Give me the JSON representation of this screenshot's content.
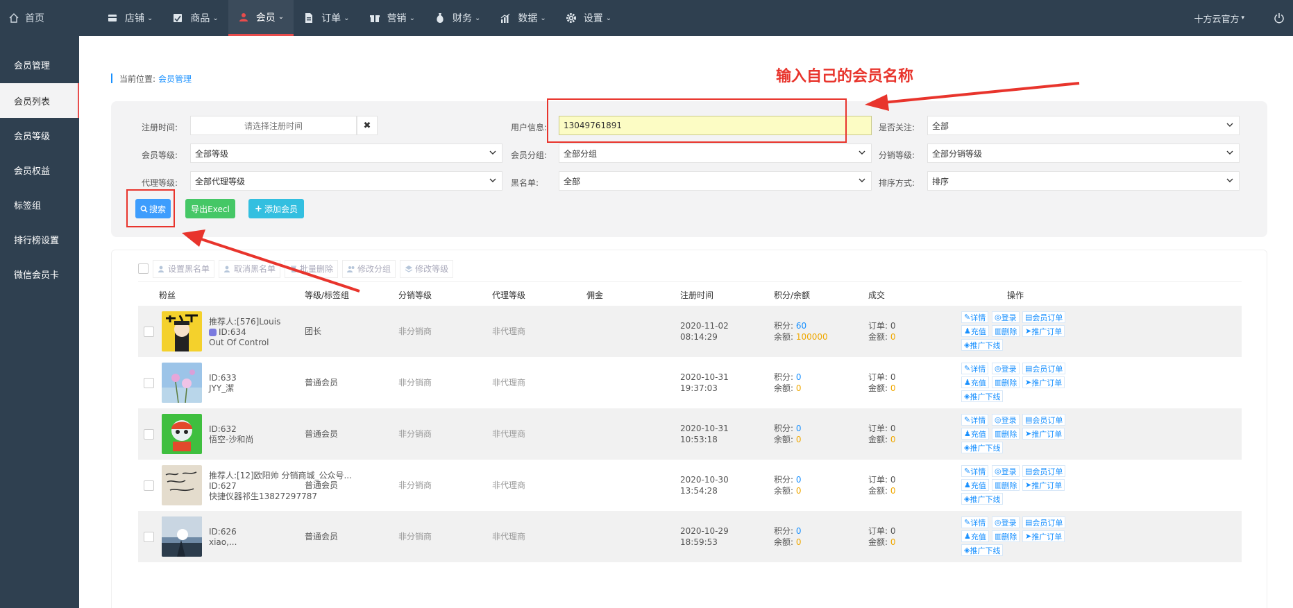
{
  "topnav": {
    "home": "首页",
    "items": [
      {
        "label": "店铺",
        "icon": "store-icon"
      },
      {
        "label": "商品",
        "icon": "product-icon"
      },
      {
        "label": "会员",
        "icon": "member-icon"
      },
      {
        "label": "订单",
        "icon": "order-icon"
      },
      {
        "label": "营销",
        "icon": "gift-icon"
      },
      {
        "label": "财务",
        "icon": "money-bag-icon"
      },
      {
        "label": "数据",
        "icon": "bar-chart-icon"
      },
      {
        "label": "设置",
        "icon": "gear-icon"
      }
    ],
    "active": "会员",
    "account": "十方云官方"
  },
  "sidebar": {
    "items": [
      "会员管理",
      "会员列表",
      "会员等级",
      "会员权益",
      "标签组",
      "排行榜设置",
      "微信会员卡"
    ],
    "active": "会员列表"
  },
  "breadcrumb": {
    "prefix": "当前位置:",
    "current": "会员管理"
  },
  "filters": {
    "reg_time": {
      "label": "注册时间:",
      "placeholder": "请选择注册时间",
      "clear": "✖"
    },
    "user_info": {
      "label": "用户信息:",
      "value": "13049761891"
    },
    "follow": {
      "label": "是否关注:",
      "value": "全部"
    },
    "member_level": {
      "label": "会员等级:",
      "value": "全部等级"
    },
    "member_group": {
      "label": "会员分组:",
      "value": "全部分组"
    },
    "dist_level": {
      "label": "分销等级:",
      "value": "全部分销等级"
    },
    "agent_level": {
      "label": "代理等级:",
      "value": "全部代理等级"
    },
    "blacklist": {
      "label": "黑名单:",
      "value": "全部"
    },
    "sort": {
      "label": "排序方式:",
      "value": "排序"
    }
  },
  "buttons": {
    "search": "搜索",
    "export": "导出Execl",
    "add": "添加会员"
  },
  "bulk": [
    "设置黑名单",
    "取消黑名单",
    "批量删除",
    "修改分组",
    "修改等级"
  ],
  "table": {
    "headers": [
      "粉丝",
      "等级/标签组",
      "分销等级",
      "代理等级",
      "佣金",
      "注册时间",
      "积分/余额",
      "成交",
      "操作"
    ],
    "rows": [
      {
        "line1": "推荐人:[576]Louis",
        "line2": "ID:634",
        "line3": "Out Of Control",
        "level": "团长",
        "dist": "非分销商",
        "agent": "非代理商",
        "date": "2020-11-02",
        "time": "08:14:29",
        "points_label": "积分:",
        "points": "60",
        "balance_label": "余额:",
        "balance": "100000",
        "orders_label": "订单:",
        "orders": "0",
        "amount_label": "金额:",
        "amount": "0"
      },
      {
        "line1": "",
        "line2": "ID:633",
        "line3": "JYY_潔",
        "level": "普通会员",
        "dist": "非分销商",
        "agent": "非代理商",
        "date": "2020-10-31",
        "time": "19:37:03",
        "points_label": "积分:",
        "points": "0",
        "balance_label": "余额:",
        "balance": "0",
        "orders_label": "订单:",
        "orders": "0",
        "amount_label": "金额:",
        "amount": "0"
      },
      {
        "line1": "",
        "line2": "ID:632",
        "line3": "悟空-沙和尚",
        "level": "普通会员",
        "dist": "非分销商",
        "agent": "非代理商",
        "date": "2020-10-31",
        "time": "10:53:18",
        "points_label": "积分:",
        "points": "0",
        "balance_label": "余额:",
        "balance": "0",
        "orders_label": "订单:",
        "orders": "0",
        "amount_label": "金额:",
        "amount": "0"
      },
      {
        "line1": "推荐人:[12]欧阳帅 分销商城_公众号...",
        "line2": "ID:627",
        "line3": "快捷仪器祁生13827297787",
        "level": "普通会员",
        "dist": "非分销商",
        "agent": "非代理商",
        "date": "2020-10-30",
        "time": "13:54:28",
        "points_label": "积分:",
        "points": "0",
        "balance_label": "余额:",
        "balance": "0",
        "orders_label": "订单:",
        "orders": "0",
        "amount_label": "金额:",
        "amount": "0"
      },
      {
        "line1": "",
        "line2": "ID:626",
        "line3": "xiao,...",
        "level": "普通会员",
        "dist": "非分销商",
        "agent": "非代理商",
        "date": "2020-10-29",
        "time": "18:59:53",
        "points_label": "积分:",
        "points": "0",
        "balance_label": "余额:",
        "balance": "0",
        "orders_label": "订单:",
        "orders": "0",
        "amount_label": "金额:",
        "amount": "0"
      }
    ],
    "ops": [
      "详情",
      "登录",
      "会员订单",
      "充值",
      "删除",
      "推广订单",
      "推广下线"
    ]
  },
  "annotation": {
    "text": "输入自己的会员名称"
  },
  "colors": {
    "nav_bg": "#2f4050",
    "accent_red": "#e8342c",
    "link_blue": "#1890ff"
  }
}
